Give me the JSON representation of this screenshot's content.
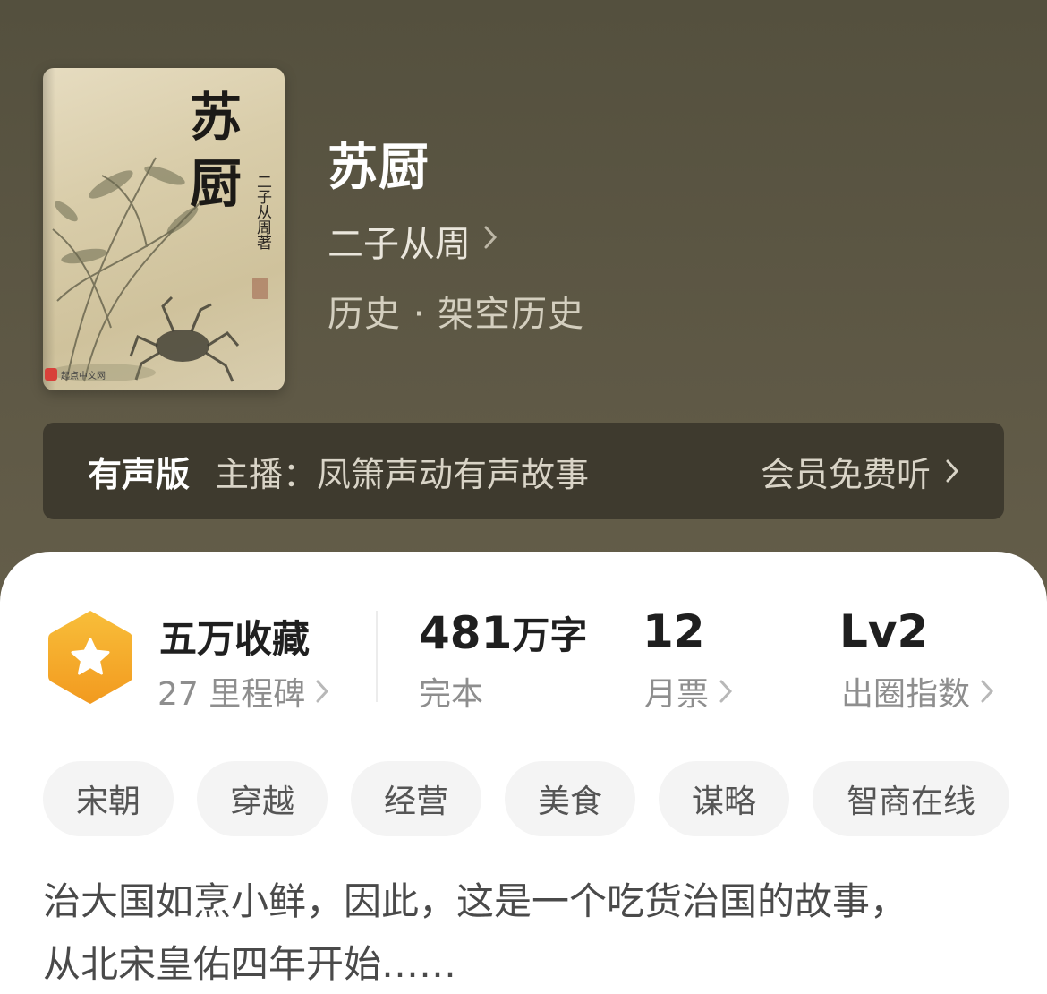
{
  "book": {
    "title": "苏厨",
    "author": "二子从周",
    "category": "历史 · 架空历史"
  },
  "cover": {
    "title_char_1": "苏",
    "title_char_2": "厨",
    "author_vertical": "二子从周著",
    "publisher": "起点中文网"
  },
  "audio": {
    "label": "有声版",
    "host": "主播：凤箫声动有声故事",
    "cta": "会员免费听"
  },
  "stats": {
    "collect_title": "五万收藏",
    "milestones": "27 里程碑",
    "word_count_number": "481",
    "word_count_unit": "万字",
    "status": "完本",
    "monthly_votes": "12",
    "monthly_votes_label": "月票",
    "level": "Lv2",
    "level_label": "出圈指数"
  },
  "tags": [
    "宋朝",
    "穿越",
    "经营",
    "美食",
    "谋略",
    "智商在线"
  ],
  "description_line_1": "治大国如烹小鲜，因此，这是一个吃货治国的故事，",
  "description_line_2": "从北宋皇佑四年开始……",
  "colors": {
    "badge_orange": "#f5a623",
    "header_bg": "#5a5443"
  }
}
